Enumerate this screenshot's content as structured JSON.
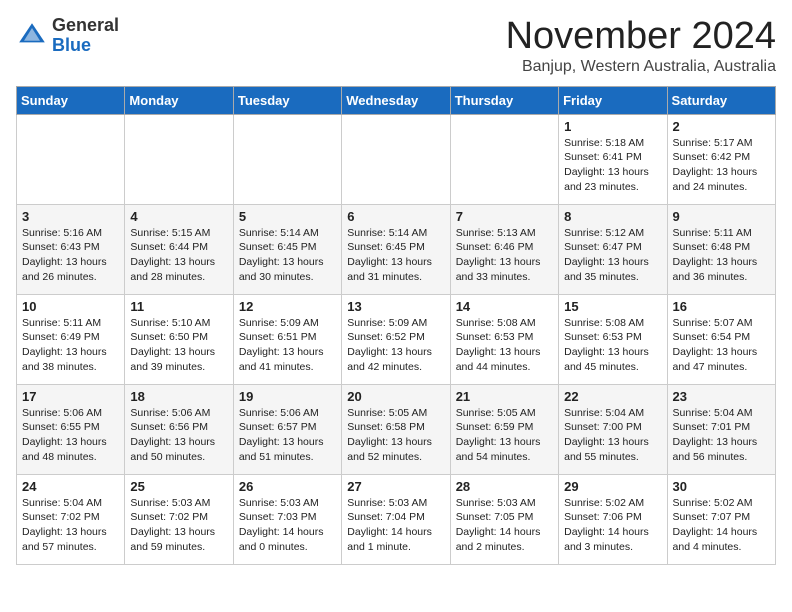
{
  "logo": {
    "general": "General",
    "blue": "Blue"
  },
  "title": "November 2024",
  "location": "Banjup, Western Australia, Australia",
  "headers": [
    "Sunday",
    "Monday",
    "Tuesday",
    "Wednesday",
    "Thursday",
    "Friday",
    "Saturday"
  ],
  "weeks": [
    [
      {
        "day": "",
        "info": ""
      },
      {
        "day": "",
        "info": ""
      },
      {
        "day": "",
        "info": ""
      },
      {
        "day": "",
        "info": ""
      },
      {
        "day": "",
        "info": ""
      },
      {
        "day": "1",
        "info": "Sunrise: 5:18 AM\nSunset: 6:41 PM\nDaylight: 13 hours\nand 23 minutes."
      },
      {
        "day": "2",
        "info": "Sunrise: 5:17 AM\nSunset: 6:42 PM\nDaylight: 13 hours\nand 24 minutes."
      }
    ],
    [
      {
        "day": "3",
        "info": "Sunrise: 5:16 AM\nSunset: 6:43 PM\nDaylight: 13 hours\nand 26 minutes."
      },
      {
        "day": "4",
        "info": "Sunrise: 5:15 AM\nSunset: 6:44 PM\nDaylight: 13 hours\nand 28 minutes."
      },
      {
        "day": "5",
        "info": "Sunrise: 5:14 AM\nSunset: 6:45 PM\nDaylight: 13 hours\nand 30 minutes."
      },
      {
        "day": "6",
        "info": "Sunrise: 5:14 AM\nSunset: 6:45 PM\nDaylight: 13 hours\nand 31 minutes."
      },
      {
        "day": "7",
        "info": "Sunrise: 5:13 AM\nSunset: 6:46 PM\nDaylight: 13 hours\nand 33 minutes."
      },
      {
        "day": "8",
        "info": "Sunrise: 5:12 AM\nSunset: 6:47 PM\nDaylight: 13 hours\nand 35 minutes."
      },
      {
        "day": "9",
        "info": "Sunrise: 5:11 AM\nSunset: 6:48 PM\nDaylight: 13 hours\nand 36 minutes."
      }
    ],
    [
      {
        "day": "10",
        "info": "Sunrise: 5:11 AM\nSunset: 6:49 PM\nDaylight: 13 hours\nand 38 minutes."
      },
      {
        "day": "11",
        "info": "Sunrise: 5:10 AM\nSunset: 6:50 PM\nDaylight: 13 hours\nand 39 minutes."
      },
      {
        "day": "12",
        "info": "Sunrise: 5:09 AM\nSunset: 6:51 PM\nDaylight: 13 hours\nand 41 minutes."
      },
      {
        "day": "13",
        "info": "Sunrise: 5:09 AM\nSunset: 6:52 PM\nDaylight: 13 hours\nand 42 minutes."
      },
      {
        "day": "14",
        "info": "Sunrise: 5:08 AM\nSunset: 6:53 PM\nDaylight: 13 hours\nand 44 minutes."
      },
      {
        "day": "15",
        "info": "Sunrise: 5:08 AM\nSunset: 6:53 PM\nDaylight: 13 hours\nand 45 minutes."
      },
      {
        "day": "16",
        "info": "Sunrise: 5:07 AM\nSunset: 6:54 PM\nDaylight: 13 hours\nand 47 minutes."
      }
    ],
    [
      {
        "day": "17",
        "info": "Sunrise: 5:06 AM\nSunset: 6:55 PM\nDaylight: 13 hours\nand 48 minutes."
      },
      {
        "day": "18",
        "info": "Sunrise: 5:06 AM\nSunset: 6:56 PM\nDaylight: 13 hours\nand 50 minutes."
      },
      {
        "day": "19",
        "info": "Sunrise: 5:06 AM\nSunset: 6:57 PM\nDaylight: 13 hours\nand 51 minutes."
      },
      {
        "day": "20",
        "info": "Sunrise: 5:05 AM\nSunset: 6:58 PM\nDaylight: 13 hours\nand 52 minutes."
      },
      {
        "day": "21",
        "info": "Sunrise: 5:05 AM\nSunset: 6:59 PM\nDaylight: 13 hours\nand 54 minutes."
      },
      {
        "day": "22",
        "info": "Sunrise: 5:04 AM\nSunset: 7:00 PM\nDaylight: 13 hours\nand 55 minutes."
      },
      {
        "day": "23",
        "info": "Sunrise: 5:04 AM\nSunset: 7:01 PM\nDaylight: 13 hours\nand 56 minutes."
      }
    ],
    [
      {
        "day": "24",
        "info": "Sunrise: 5:04 AM\nSunset: 7:02 PM\nDaylight: 13 hours\nand 57 minutes."
      },
      {
        "day": "25",
        "info": "Sunrise: 5:03 AM\nSunset: 7:02 PM\nDaylight: 13 hours\nand 59 minutes."
      },
      {
        "day": "26",
        "info": "Sunrise: 5:03 AM\nSunset: 7:03 PM\nDaylight: 14 hours\nand 0 minutes."
      },
      {
        "day": "27",
        "info": "Sunrise: 5:03 AM\nSunset: 7:04 PM\nDaylight: 14 hours\nand 1 minute."
      },
      {
        "day": "28",
        "info": "Sunrise: 5:03 AM\nSunset: 7:05 PM\nDaylight: 14 hours\nand 2 minutes."
      },
      {
        "day": "29",
        "info": "Sunrise: 5:02 AM\nSunset: 7:06 PM\nDaylight: 14 hours\nand 3 minutes."
      },
      {
        "day": "30",
        "info": "Sunrise: 5:02 AM\nSunset: 7:07 PM\nDaylight: 14 hours\nand 4 minutes."
      }
    ]
  ]
}
